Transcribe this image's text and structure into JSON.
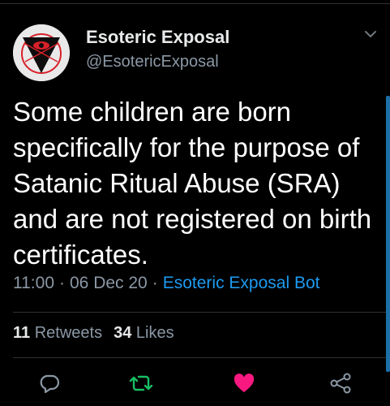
{
  "author": {
    "display_name": "Esoteric Exposal",
    "handle": "@EsotericExposal",
    "avatar_icon": "eye-triangle-logo"
  },
  "tweet": {
    "text": "Some children are born specifically for the purpose of Satanic Ritual Abuse (SRA) and are not registered on birth certificates.",
    "time": "11:00",
    "date": "06 Dec 20",
    "separator": "·",
    "source": "Esoteric Exposal Bot"
  },
  "stats": {
    "retweets_count": "11",
    "retweets_label": "Retweets",
    "likes_count": "34",
    "likes_label": "Likes"
  },
  "actions": [
    {
      "name": "reply",
      "icon": "reply-bubble-icon"
    },
    {
      "name": "retweet",
      "icon": "retweet-icon",
      "color": "#17bf63"
    },
    {
      "name": "like",
      "icon": "heart-icon",
      "color": "#f91880"
    },
    {
      "name": "share",
      "icon": "share-icon"
    }
  ],
  "colors": {
    "background": "#000000",
    "text": "#ffffff",
    "secondary": "#8b98a5",
    "link": "#1d9bf0"
  }
}
